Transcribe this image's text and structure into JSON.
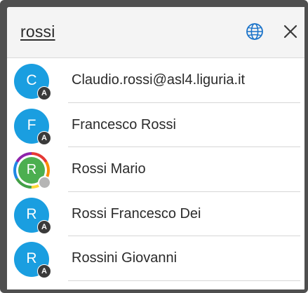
{
  "search": {
    "query": "rossi"
  },
  "header": {
    "globe_icon": "globe-icon",
    "close_icon": "close-icon"
  },
  "colors": {
    "avatar_blue": "#1a9ee0",
    "avatar_green": "#4caf50",
    "badge_dark": "#3a3a3a",
    "frame": "#4f4f4f",
    "header_bg": "#f4f4f4",
    "accent_icon": "#1a73c9"
  },
  "results": [
    {
      "initial": "C",
      "badge": "A",
      "name": "Claudio.rossi@asl4.liguria.it"
    },
    {
      "initial": "F",
      "badge": "A",
      "name": "Francesco Rossi"
    },
    {
      "initial": "R",
      "badge": "",
      "name": "Rossi Mario",
      "avatar_style": "ring",
      "status": "offline"
    },
    {
      "initial": "R",
      "badge": "A",
      "name": "Rossi Francesco Dei"
    },
    {
      "initial": "R",
      "badge": "A",
      "name": "Rossini Giovanni"
    }
  ]
}
